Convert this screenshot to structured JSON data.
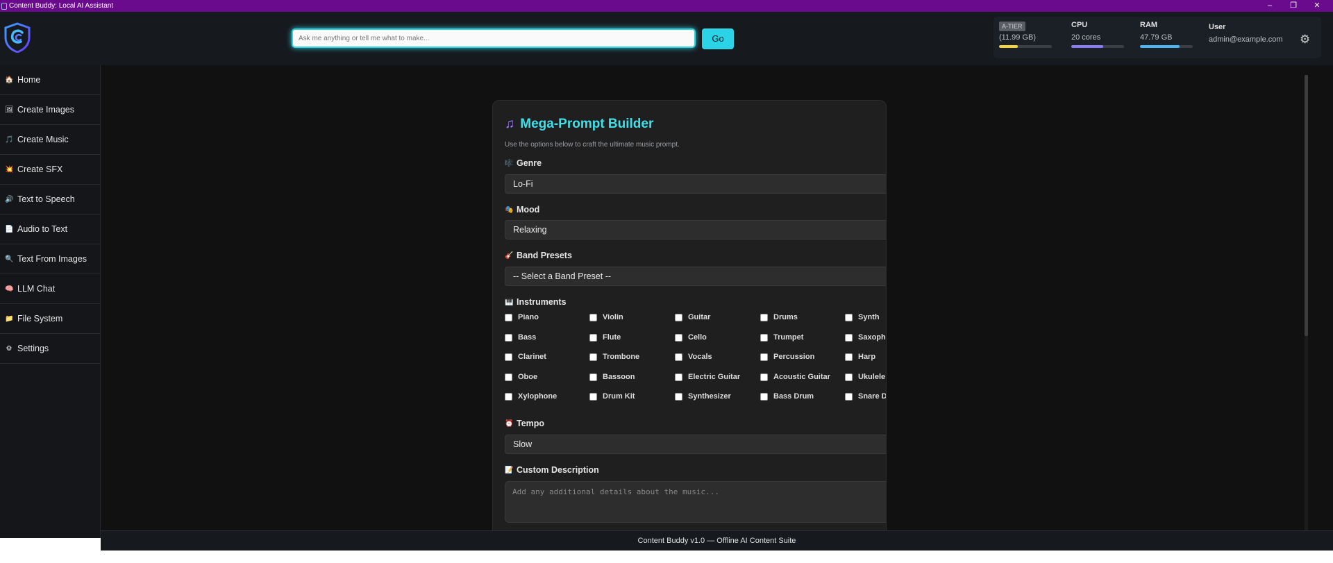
{
  "window": {
    "title": "Content Buddy: Local AI Assistant",
    "controls": [
      "–",
      "❐",
      "✕"
    ]
  },
  "header": {
    "search_placeholder": "Ask me anything or tell me what to make...",
    "go_label": "Go",
    "stats": {
      "tier_badge": "A-TIER",
      "tier_value": "(11.99 GB)",
      "tier_usage": 0.35,
      "cpu_label": "CPU",
      "cpu_value": "20 cores",
      "cpu_usage": 0.6,
      "ram_label": "RAM",
      "ram_value": "47.79 GB",
      "ram_usage": 0.75,
      "user_label": "User",
      "user_value": "admin@example.com"
    }
  },
  "sidebar": {
    "items": [
      {
        "icon": "🏠",
        "label": "Home"
      },
      {
        "icon": "🖼",
        "label": "Create Images"
      },
      {
        "icon": "🎵",
        "label": "Create Music"
      },
      {
        "icon": "💥",
        "label": "Create SFX"
      },
      {
        "icon": "🔊",
        "label": "Text to Speech"
      },
      {
        "icon": "📄",
        "label": "Audio to Text"
      },
      {
        "icon": "🔍",
        "label": "Text From Images"
      },
      {
        "icon": "🧠",
        "label": "LLM Chat"
      },
      {
        "icon": "📁",
        "label": "File System"
      },
      {
        "icon": "⚙",
        "label": "Settings"
      }
    ]
  },
  "builder": {
    "title_icon": "♫",
    "title": "Mega-Prompt Builder",
    "subtitle": "Use the options below to craft the ultimate music prompt.",
    "genre": {
      "icon": "🎼",
      "label": "Genre",
      "value": "Lo-Fi"
    },
    "mood": {
      "icon": "🎭",
      "label": "Mood",
      "value": "Relaxing"
    },
    "band": {
      "icon": "🎸",
      "label": "Band Presets",
      "value": "-- Select a Band Preset --"
    },
    "instruments": {
      "icon": "🎹",
      "label": "Instruments",
      "items": [
        "Piano",
        "Violin",
        "Guitar",
        "Drums",
        "Synth",
        "Bass",
        "Flute",
        "Cello",
        "Trumpet",
        "Saxophone",
        "Clarinet",
        "Trombone",
        "Vocals",
        "Percussion",
        "Harp",
        "Oboe",
        "Bassoon",
        "Electric Guitar",
        "Acoustic Guitar",
        "Ukulele",
        "Xylophone",
        "Drum Kit",
        "Synthesizer",
        "Bass Drum",
        "Snare Drum"
      ]
    },
    "tempo": {
      "icon": "⏰",
      "label": "Tempo",
      "value": "Slow"
    },
    "custom": {
      "icon": "📝",
      "label": "Custom Description",
      "placeholder": "Add any additional details about the music..."
    }
  },
  "footer": {
    "text": "Content Buddy v1.0 — Offline AI Content Suite"
  },
  "colors": {
    "accent": "#3fe0ea",
    "titlebar": "#6a0a8c",
    "tier_bar": "#f5d33b",
    "cpu_bar": "#8b7cf6",
    "ram_bar": "#49b6f2"
  }
}
